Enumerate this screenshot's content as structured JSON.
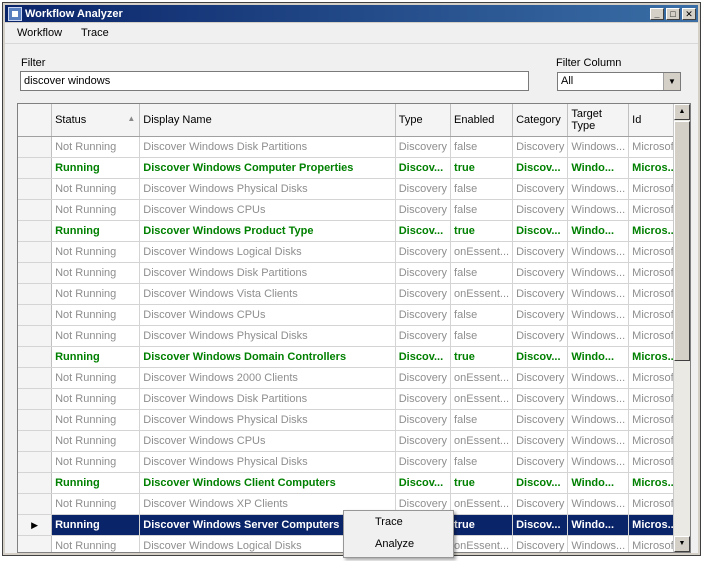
{
  "window": {
    "title": "Workflow Analyzer"
  },
  "menu": {
    "items": [
      "Workflow",
      "Trace"
    ]
  },
  "filter": {
    "label": "Filter",
    "value": "discover windows"
  },
  "filter_column": {
    "label": "Filter Column",
    "value": "All"
  },
  "columns": [
    "Status",
    "Display Name",
    "Type",
    "Enabled",
    "Category",
    "Target Type",
    "Id"
  ],
  "rows": [
    {
      "status": "Not Running",
      "name": "Discover Windows Disk Partitions",
      "type": "Discovery",
      "enabled": "false",
      "category": "Discovery",
      "target": "Windows...",
      "id": "Microsoft..."
    },
    {
      "status": "Running",
      "name": "Discover Windows Computer Properties",
      "type": "Discov...",
      "enabled": "true",
      "category": "Discov...",
      "target": "Windo...",
      "id": "Micros..."
    },
    {
      "status": "Not Running",
      "name": "Discover Windows Physical Disks",
      "type": "Discovery",
      "enabled": "false",
      "category": "Discovery",
      "target": "Windows...",
      "id": "Microsoft..."
    },
    {
      "status": "Not Running",
      "name": "Discover Windows CPUs",
      "type": "Discovery",
      "enabled": "false",
      "category": "Discovery",
      "target": "Windows...",
      "id": "Microsoft..."
    },
    {
      "status": "Running",
      "name": "Discover Windows Product Type",
      "type": "Discov...",
      "enabled": "true",
      "category": "Discov...",
      "target": "Windo...",
      "id": "Micros..."
    },
    {
      "status": "Not Running",
      "name": "Discover Windows Logical Disks",
      "type": "Discovery",
      "enabled": "onEssent...",
      "category": "Discovery",
      "target": "Windows...",
      "id": "Microsoft..."
    },
    {
      "status": "Not Running",
      "name": "Discover Windows Disk Partitions",
      "type": "Discovery",
      "enabled": "false",
      "category": "Discovery",
      "target": "Windows...",
      "id": "Microsoft..."
    },
    {
      "status": "Not Running",
      "name": "Discover Windows Vista Clients",
      "type": "Discovery",
      "enabled": "onEssent...",
      "category": "Discovery",
      "target": "Windows...",
      "id": "Microsoft..."
    },
    {
      "status": "Not Running",
      "name": "Discover Windows CPUs",
      "type": "Discovery",
      "enabled": "false",
      "category": "Discovery",
      "target": "Windows...",
      "id": "Microsoft..."
    },
    {
      "status": "Not Running",
      "name": "Discover Windows Physical Disks",
      "type": "Discovery",
      "enabled": "false",
      "category": "Discovery",
      "target": "Windows...",
      "id": "Microsoft..."
    },
    {
      "status": "Running",
      "name": "Discover Windows Domain Controllers",
      "type": "Discov...",
      "enabled": "true",
      "category": "Discov...",
      "target": "Windo...",
      "id": "Micros..."
    },
    {
      "status": "Not Running",
      "name": "Discover Windows 2000 Clients",
      "type": "Discovery",
      "enabled": "onEssent...",
      "category": "Discovery",
      "target": "Windows...",
      "id": "Microsoft..."
    },
    {
      "status": "Not Running",
      "name": "Discover Windows Disk Partitions",
      "type": "Discovery",
      "enabled": "onEssent...",
      "category": "Discovery",
      "target": "Windows...",
      "id": "Microsoft..."
    },
    {
      "status": "Not Running",
      "name": "Discover Windows Physical Disks",
      "type": "Discovery",
      "enabled": "false",
      "category": "Discovery",
      "target": "Windows...",
      "id": "Microsoft..."
    },
    {
      "status": "Not Running",
      "name": "Discover Windows CPUs",
      "type": "Discovery",
      "enabled": "onEssent...",
      "category": "Discovery",
      "target": "Windows...",
      "id": "Microsoft..."
    },
    {
      "status": "Not Running",
      "name": "Discover Windows Physical Disks",
      "type": "Discovery",
      "enabled": "false",
      "category": "Discovery",
      "target": "Windows...",
      "id": "Microsoft..."
    },
    {
      "status": "Running",
      "name": "Discover Windows Client Computers",
      "type": "Discov...",
      "enabled": "true",
      "category": "Discov...",
      "target": "Windo...",
      "id": "Micros..."
    },
    {
      "status": "Not Running",
      "name": "Discover Windows XP Clients",
      "type": "Discovery",
      "enabled": "onEssent...",
      "category": "Discovery",
      "target": "Windows...",
      "id": "Microsoft..."
    },
    {
      "status": "Running",
      "name": "Discover Windows Server Computers",
      "type": "Discov...",
      "enabled": "true",
      "category": "Discov...",
      "target": "Windo...",
      "id": "Micros...",
      "selected": true
    },
    {
      "status": "Not Running",
      "name": "Discover Windows Logical Disks",
      "type": "Discovery",
      "enabled": "onEssent...",
      "category": "Discovery",
      "target": "Windows...",
      "id": "Microsoft..."
    }
  ],
  "context_menu": {
    "items": [
      "Trace",
      "Analyze"
    ]
  },
  "colors": {
    "running": "#008000",
    "not_running": "#8e8e8e",
    "selection": "#0a246a",
    "titlebar": "#0a246a"
  }
}
